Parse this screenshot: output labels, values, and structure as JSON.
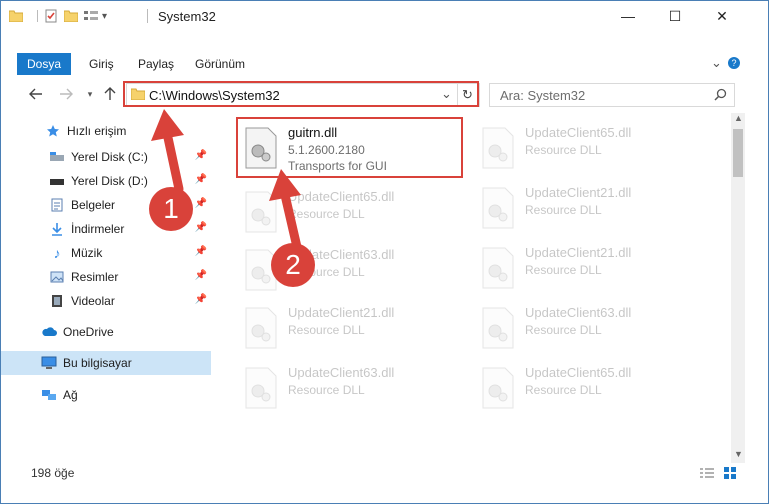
{
  "window": {
    "title": "System32",
    "minimize": "—",
    "maximize": "☐",
    "close": "✕"
  },
  "ribbon": {
    "tabs": [
      "Dosya",
      "Giriş",
      "Paylaş",
      "Görünüm"
    ],
    "expand": "⌄",
    "help": "?"
  },
  "address": {
    "path": "C:\\Windows\\System32",
    "dropdown": "⌄",
    "refresh": "↻"
  },
  "search": {
    "placeholder": "Ara: System32"
  },
  "sidebar": {
    "items": [
      {
        "label": "Hızlı erişim",
        "icon": "star-icon"
      },
      {
        "label": "Yerel Disk (C:)",
        "icon": "drive-icon"
      },
      {
        "label": "Yerel Disk (D:)",
        "icon": "drive-icon"
      },
      {
        "label": "Belgeler",
        "icon": "documents-icon"
      },
      {
        "label": "İndirmeler",
        "icon": "download-icon"
      },
      {
        "label": "Müzik",
        "icon": "music-icon"
      },
      {
        "label": "Resimler",
        "icon": "pictures-icon"
      },
      {
        "label": "Videolar",
        "icon": "videos-icon"
      },
      {
        "label": "OneDrive",
        "icon": "cloud-icon"
      },
      {
        "label": "Bu bilgisayar",
        "icon": "computer-icon"
      },
      {
        "label": "Ağ",
        "icon": "network-icon"
      }
    ]
  },
  "files": {
    "highlighted": {
      "name": "guitrn.dll",
      "version": "5.1.2600.2180",
      "description": "Transports for GUI"
    },
    "col1": [
      {
        "name": "UpdateClient65.dll",
        "desc": "Resource DLL"
      },
      {
        "name": "UpdateClient63.dll",
        "desc": "Resource DLL"
      },
      {
        "name": "UpdateClient21.dll",
        "desc": "Resource DLL"
      },
      {
        "name": "UpdateClient63.dll",
        "desc": "Resource DLL"
      }
    ],
    "col2": [
      {
        "name": "UpdateClient65.dll",
        "desc": "Resource DLL"
      },
      {
        "name": "UpdateClient21.dll",
        "desc": "Resource DLL"
      },
      {
        "name": "UpdateClient21.dll",
        "desc": "Resource DLL"
      },
      {
        "name": "UpdateClient63.dll",
        "desc": "Resource DLL"
      },
      {
        "name": "UpdateClient65.dll",
        "desc": "Resource DLL"
      }
    ]
  },
  "status": {
    "count": "198 öğe"
  },
  "annotations": {
    "step1": "1",
    "step2": "2"
  },
  "colors": {
    "accent": "#1979ca",
    "highlight": "#d9423a",
    "selection": "#cce4f7"
  }
}
